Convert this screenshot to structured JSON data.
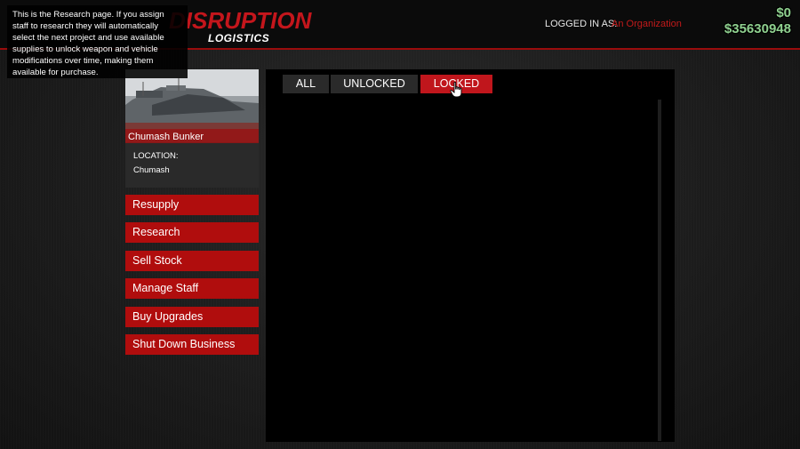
{
  "header": {
    "logo_main": "DISRUPTION",
    "logo_sub": "LOGISTICS",
    "logged_in_label": "LOGGED IN AS:",
    "logged_in_name": "An Organization",
    "cash": "$0",
    "bank": "$35630948"
  },
  "tooltip": {
    "text": "This is the Research page. If you assign staff to research they will automatically select the next project and use available supplies to unlock weapon and vehicle modifications over time, making them available for purchase."
  },
  "property": {
    "name": "Chumash Bunker",
    "location_label": "LOCATION:",
    "location_value": "Chumash"
  },
  "nav": [
    {
      "label": "Resupply"
    },
    {
      "label": "Research"
    },
    {
      "label": "Sell Stock"
    },
    {
      "label": "Manage Staff"
    },
    {
      "label": "Buy Upgrades"
    },
    {
      "label": "Shut Down Business"
    }
  ],
  "tabs": [
    {
      "label": "ALL",
      "active": false
    },
    {
      "label": "UNLOCKED",
      "active": false
    },
    {
      "label": "LOCKED",
      "active": true
    }
  ],
  "colors": {
    "accent_red": "#c0161c",
    "button_red": "#b00d0d",
    "money_green": "#8fd08f",
    "org_name_red": "#c21a1a"
  },
  "icons": {
    "cursor": "hand-pointer-icon"
  }
}
